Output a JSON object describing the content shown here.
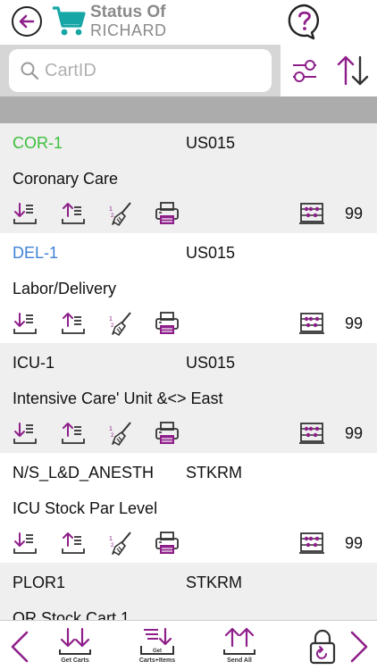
{
  "header": {
    "title": "Status Of",
    "subtitle": "RICHARD",
    "back_icon": "back-arrow-icon",
    "cart_icon": "shopping-cart-icon",
    "help_icon": "help-icon"
  },
  "search": {
    "placeholder": "CartID",
    "value": ""
  },
  "colors": {
    "accent": "#8e1f8a",
    "teal": "#16a6a6",
    "green_id": "#3dbf3d",
    "blue_id": "#3f82d6"
  },
  "carts": [
    {
      "id": "COR-1",
      "id_color": "#3dbf3d",
      "location": "US015",
      "description": "Coronary Care",
      "count": "99"
    },
    {
      "id": "DEL-1",
      "id_color": "#3f82d6",
      "location": "US015",
      "description": "Labor/Delivery",
      "count": "99"
    },
    {
      "id": "ICU-1",
      "id_color": "#111111",
      "location": "US015",
      "description": "Intensive Care' Unit &<> East",
      "count": "99"
    },
    {
      "id": "N/S_L&D_ANESTH",
      "id_color": "#111111",
      "location": "STKRM",
      "description": "ICU Stock Par Level",
      "count": "99"
    },
    {
      "id": "PLOR1",
      "id_color": "#111111",
      "location": "STKRM",
      "description": "OR Stock Cart 1",
      "count": ""
    }
  ],
  "toolbar": {
    "get_carts": "Get Carts",
    "get_carts_items": "Carts+Items",
    "get_small": "Get",
    "send_all": "Send All"
  }
}
